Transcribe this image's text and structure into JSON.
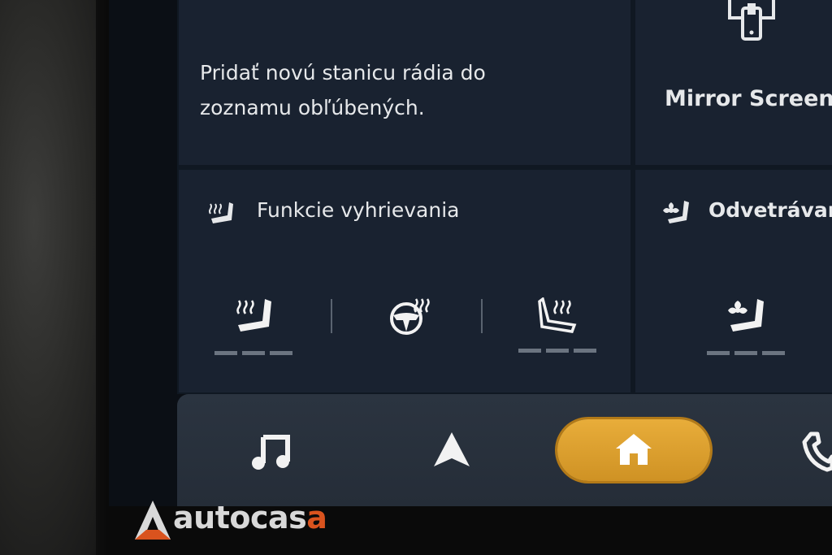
{
  "tiles": {
    "radio": {
      "line1": "Pridať novú stanicu rádia do",
      "line2": "zoznamu obľúbených."
    },
    "mirror": {
      "label": "Mirror Screen",
      "icon": "mirror-screen-icon"
    },
    "heating": {
      "title": "Funkcie vyhrievania",
      "icon": "seat-heat-icon",
      "controls": [
        {
          "icon": "seat-heat-left-icon",
          "level_steps": 3
        },
        {
          "icon": "steering-wheel-heat-icon"
        },
        {
          "icon": "seat-heat-right-icon",
          "level_steps": 3
        }
      ]
    },
    "ventilation": {
      "title": "Odvetrávanie",
      "icon": "seat-vent-icon",
      "controls": [
        {
          "icon": "seat-vent-left-icon",
          "level_steps": 3
        }
      ]
    }
  },
  "dock": {
    "items": [
      {
        "name": "music",
        "icon": "music-note-icon"
      },
      {
        "name": "navigation",
        "icon": "navigation-arrow-icon"
      },
      {
        "name": "home",
        "icon": "home-icon",
        "active": true
      },
      {
        "name": "phone",
        "icon": "phone-icon"
      }
    ]
  },
  "colors": {
    "accent": "#e0a232",
    "tile": "#192230",
    "text": "#e6e8ea"
  },
  "watermark": {
    "prefix": "",
    "main": "autocas",
    "suffix": "a"
  }
}
